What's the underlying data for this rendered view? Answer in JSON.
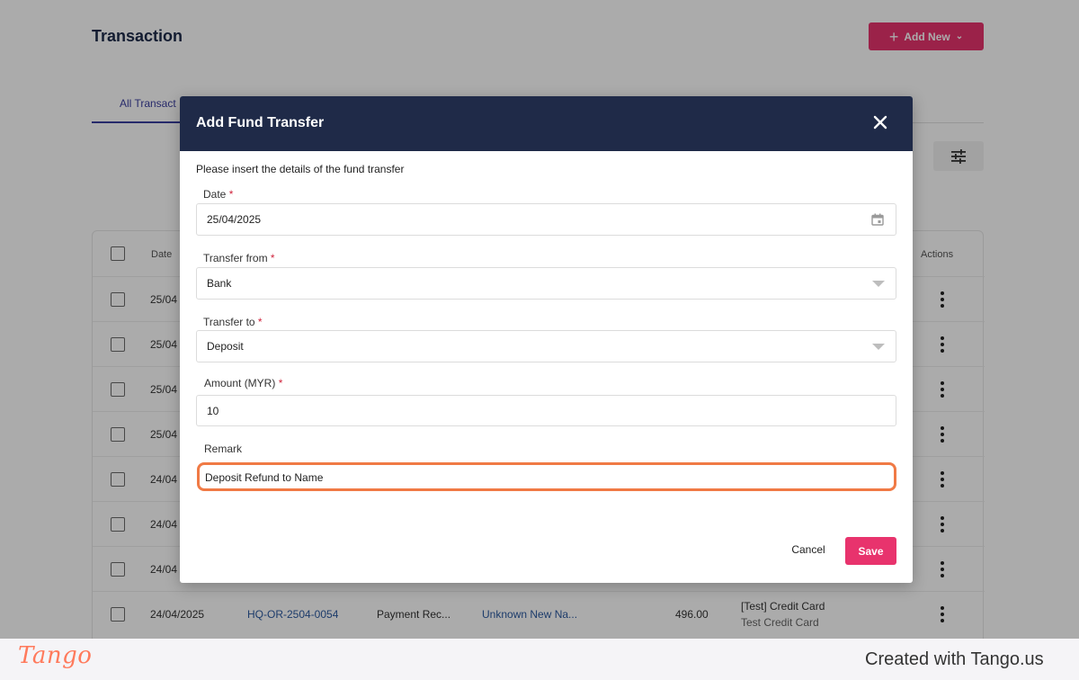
{
  "page": {
    "title": "Transaction",
    "add_new_label": "Add New",
    "tabs": [
      {
        "label": "All Transact"
      }
    ]
  },
  "table": {
    "headers": {
      "checkbox": "",
      "date": "Date",
      "actions": "Actions"
    },
    "rows": [
      {
        "date": "25/04"
      },
      {
        "date": "25/04"
      },
      {
        "date": "25/04"
      },
      {
        "date": "25/04"
      },
      {
        "date": "24/04"
      },
      {
        "date": "24/04"
      },
      {
        "date": "24/04"
      },
      {
        "date": "24/04/2025",
        "ref": "HQ-OR-2504-0054",
        "type": "Payment Rec...",
        "name": "Unknown New Na...",
        "amount": "496.00",
        "account": "[Test] Credit Card",
        "account_sub": "Test Credit Card"
      }
    ]
  },
  "modal": {
    "title": "Add Fund Transfer",
    "intro": "Please insert the details of the fund transfer",
    "fields": {
      "date": {
        "label": "Date",
        "required": "*",
        "value": "25/04/2025"
      },
      "transfer_from": {
        "label": "Transfer from",
        "required": "*",
        "value": "Bank"
      },
      "transfer_to": {
        "label": "Transfer to",
        "required": "*",
        "value": "Deposit"
      },
      "amount": {
        "label": "Amount (MYR)",
        "required": "*",
        "value": "10"
      },
      "remark": {
        "label": "Remark",
        "value": "Deposit Refund to Name"
      }
    },
    "cancel_label": "Cancel",
    "save_label": "Save"
  },
  "footer": {
    "logo": "Tango",
    "credit": "Created with Tango.us"
  },
  "colors": {
    "accent": "#e8336d",
    "modal_header": "#1f2a48",
    "highlight": "#f07a45",
    "link": "#2c5aa0"
  }
}
